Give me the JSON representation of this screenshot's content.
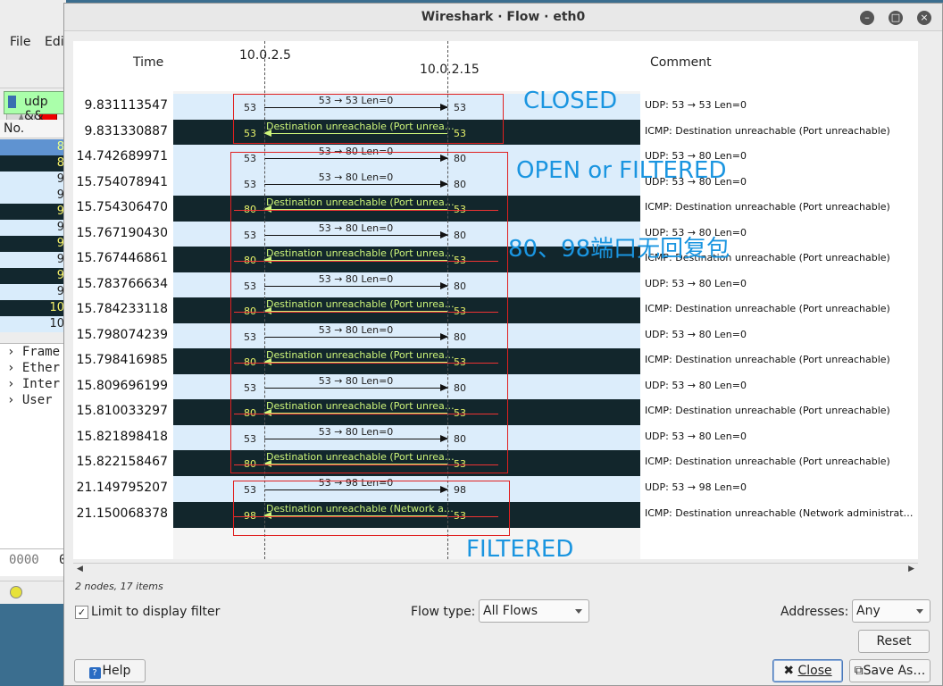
{
  "background_app": {
    "menu": [
      "File",
      "Edi"
    ],
    "filter_text": "udp &&",
    "packet_list_header": "No.",
    "packet_numbers": [
      "8",
      "8",
      "9",
      "9",
      "9",
      "9",
      "9",
      "9",
      "9",
      "9",
      "10",
      "10"
    ],
    "detail_tree": [
      "Frame",
      "Ether",
      "Inter",
      "User"
    ],
    "bytes_offset": "0000",
    "bytes_first": "0"
  },
  "window": {
    "title": "Wireshark · Flow · eth0",
    "controls": [
      "minimize",
      "maximize",
      "close"
    ]
  },
  "flow": {
    "time_header": "Time",
    "comment_header": "Comment",
    "node_a": "10.0.2.5",
    "node_b": "10.0.2.15",
    "rows": [
      {
        "time": "9.831113547",
        "label": "53 → 53 Len=0",
        "left_port": "53",
        "right_port": "53",
        "dir": "right",
        "comment": "UDP: 53 → 53 Len=0"
      },
      {
        "time": "9.831330887",
        "label": "Destination unreachable (Port unrea…",
        "left_port": "53",
        "right_port": "53",
        "dir": "left",
        "comment": "ICMP: Destination unreachable (Port unreachable)"
      },
      {
        "time": "14.742689971",
        "label": "53 → 80 Len=0",
        "left_port": "53",
        "right_port": "80",
        "dir": "right",
        "comment": "UDP: 53 → 80 Len=0"
      },
      {
        "time": "15.754078941",
        "label": "53 → 80 Len=0",
        "left_port": "53",
        "right_port": "80",
        "dir": "right",
        "comment": "UDP: 53 → 80 Len=0"
      },
      {
        "time": "15.754306470",
        "label": "Destination unreachable (Port unrea…",
        "left_port": "80",
        "right_port": "53",
        "dir": "left",
        "comment": "ICMP: Destination unreachable (Port unreachable)"
      },
      {
        "time": "15.767190430",
        "label": "53 → 80 Len=0",
        "left_port": "53",
        "right_port": "80",
        "dir": "right",
        "comment": "UDP: 53 → 80 Len=0"
      },
      {
        "time": "15.767446861",
        "label": "Destination unreachable (Port unrea…",
        "left_port": "80",
        "right_port": "53",
        "dir": "left",
        "comment": "ICMP: Destination unreachable (Port unreachable)"
      },
      {
        "time": "15.783766634",
        "label": "53 → 80 Len=0",
        "left_port": "53",
        "right_port": "80",
        "dir": "right",
        "comment": "UDP: 53 → 80 Len=0"
      },
      {
        "time": "15.784233118",
        "label": "Destination unreachable (Port unrea…",
        "left_port": "80",
        "right_port": "53",
        "dir": "left",
        "comment": "ICMP: Destination unreachable (Port unreachable)"
      },
      {
        "time": "15.798074239",
        "label": "53 → 80 Len=0",
        "left_port": "53",
        "right_port": "80",
        "dir": "right",
        "comment": "UDP: 53 → 80 Len=0"
      },
      {
        "time": "15.798416985",
        "label": "Destination unreachable (Port unrea…",
        "left_port": "80",
        "right_port": "53",
        "dir": "left",
        "comment": "ICMP: Destination unreachable (Port unreachable)"
      },
      {
        "time": "15.809696199",
        "label": "53 → 80 Len=0",
        "left_port": "53",
        "right_port": "80",
        "dir": "right",
        "comment": "UDP: 53 → 80 Len=0"
      },
      {
        "time": "15.810033297",
        "label": "Destination unreachable (Port unrea…",
        "left_port": "80",
        "right_port": "53",
        "dir": "left",
        "comment": "ICMP: Destination unreachable (Port unreachable)"
      },
      {
        "time": "15.821898418",
        "label": "53 → 80 Len=0",
        "left_port": "53",
        "right_port": "80",
        "dir": "right",
        "comment": "UDP: 53 → 80 Len=0"
      },
      {
        "time": "15.822158467",
        "label": "Destination unreachable (Port unrea…",
        "left_port": "80",
        "right_port": "53",
        "dir": "left",
        "comment": "ICMP: Destination unreachable (Port unreachable)"
      },
      {
        "time": "21.149795207",
        "label": "53 → 98 Len=0",
        "left_port": "53",
        "right_port": "98",
        "dir": "right",
        "comment": "UDP: 53 → 98 Len=0"
      },
      {
        "time": "21.150068378",
        "label": "Destination unreachable (Network a…",
        "left_port": "98",
        "right_port": "53",
        "dir": "left",
        "comment": "ICMP: Destination unreachable (Network administrativ…"
      }
    ],
    "annotations": {
      "closed": "CLOSED",
      "open_filtered": "OPEN or FILTERED",
      "no_reply": "80、98端口无回复包",
      "filtered": "FILTERED"
    }
  },
  "footer": {
    "info": "2 nodes, 17 items",
    "limit_label": "Limit to display filter",
    "limit_checked": true,
    "flow_type_label": "Flow type:",
    "flow_type_value": "All Flows",
    "addresses_label": "Addresses:",
    "addresses_value": "Any",
    "reset": "Reset",
    "help": "Help",
    "close": "Close",
    "save_as": "Save As…"
  },
  "colors": {
    "light_row": "#dcedfb",
    "dark_row": "#12262c",
    "annotation_blue": "#1a95e0",
    "annotation_red": "#e02020"
  }
}
